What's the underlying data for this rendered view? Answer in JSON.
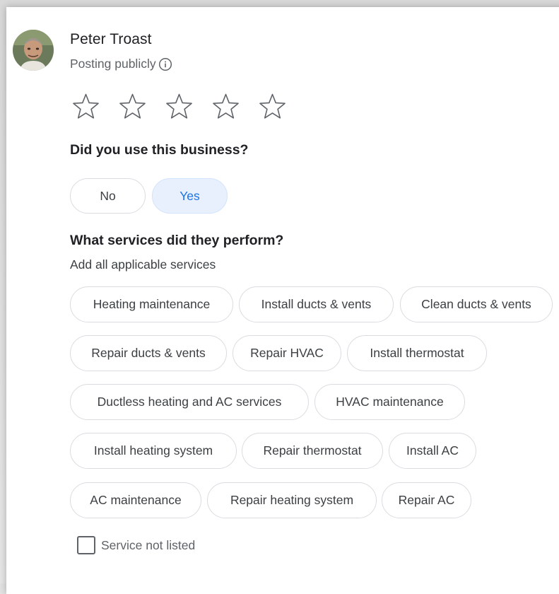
{
  "user": {
    "name": "Peter Troast",
    "posting_status": "Posting publicly"
  },
  "rating": {
    "max_stars": 5,
    "selected_stars": 0
  },
  "used_business": {
    "question": "Did you use this business?",
    "options": {
      "no": "No",
      "yes": "Yes"
    },
    "selected": "Yes"
  },
  "services": {
    "question": "What services did they perform?",
    "subtitle": "Add all applicable services",
    "chips": [
      "Heating maintenance",
      "Install ducts & vents",
      "Clean ducts & vents",
      "Repair ducts & vents",
      "Repair HVAC",
      "Install thermostat",
      "Ductless heating and AC services",
      "HVAC maintenance",
      "Install heating system",
      "Repair thermostat",
      "Install AC",
      "AC maintenance",
      "Repair heating system",
      "Repair AC"
    ],
    "not_listed_label": "Service not listed",
    "not_listed_checked": false
  },
  "colors": {
    "accent": "#1a73e8",
    "selected_bg": "#e8f0fe",
    "border": "#dadce0",
    "text_primary": "#202124",
    "text_secondary": "#5f6368"
  }
}
